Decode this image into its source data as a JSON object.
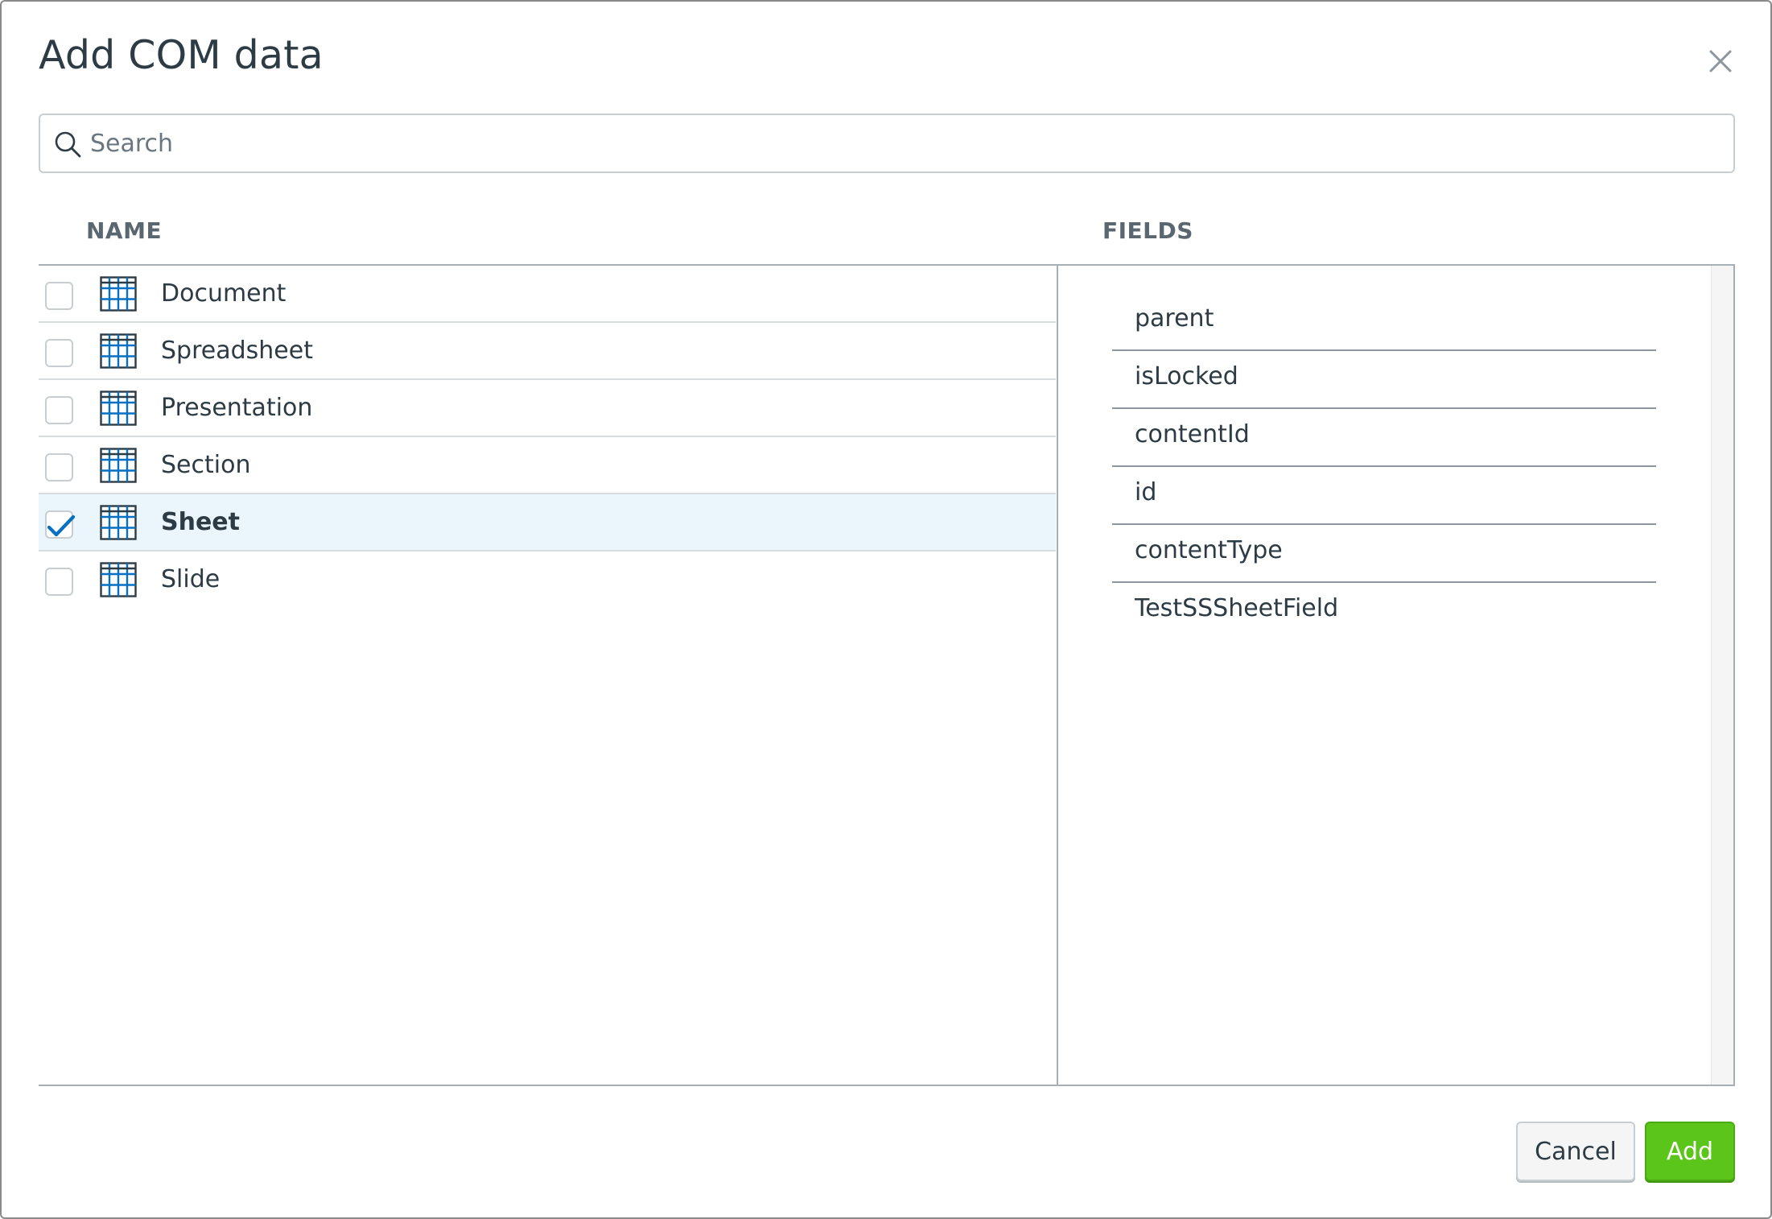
{
  "dialog": {
    "title": "Add COM data",
    "close_icon": "close-icon"
  },
  "search": {
    "placeholder": "Search",
    "value": "",
    "icon": "search-icon"
  },
  "columns": {
    "name": "NAME",
    "fields": "FIELDS"
  },
  "items": [
    {
      "label": "Document",
      "checked": false,
      "icon": "table-icon"
    },
    {
      "label": "Spreadsheet",
      "checked": false,
      "icon": "table-icon"
    },
    {
      "label": "Presentation",
      "checked": false,
      "icon": "table-icon"
    },
    {
      "label": "Section",
      "checked": false,
      "icon": "table-icon"
    },
    {
      "label": "Sheet",
      "checked": true,
      "icon": "table-icon"
    },
    {
      "label": "Slide",
      "checked": false,
      "icon": "table-icon"
    }
  ],
  "fields": [
    "parent",
    "isLocked",
    "contentId",
    "id",
    "contentType",
    "TestSSSheetField"
  ],
  "footer": {
    "cancel_label": "Cancel",
    "add_label": "Add"
  },
  "colors": {
    "accent": "#0770c2",
    "selected_row": "#eaf5fc",
    "add_button": "#5cc51a"
  }
}
